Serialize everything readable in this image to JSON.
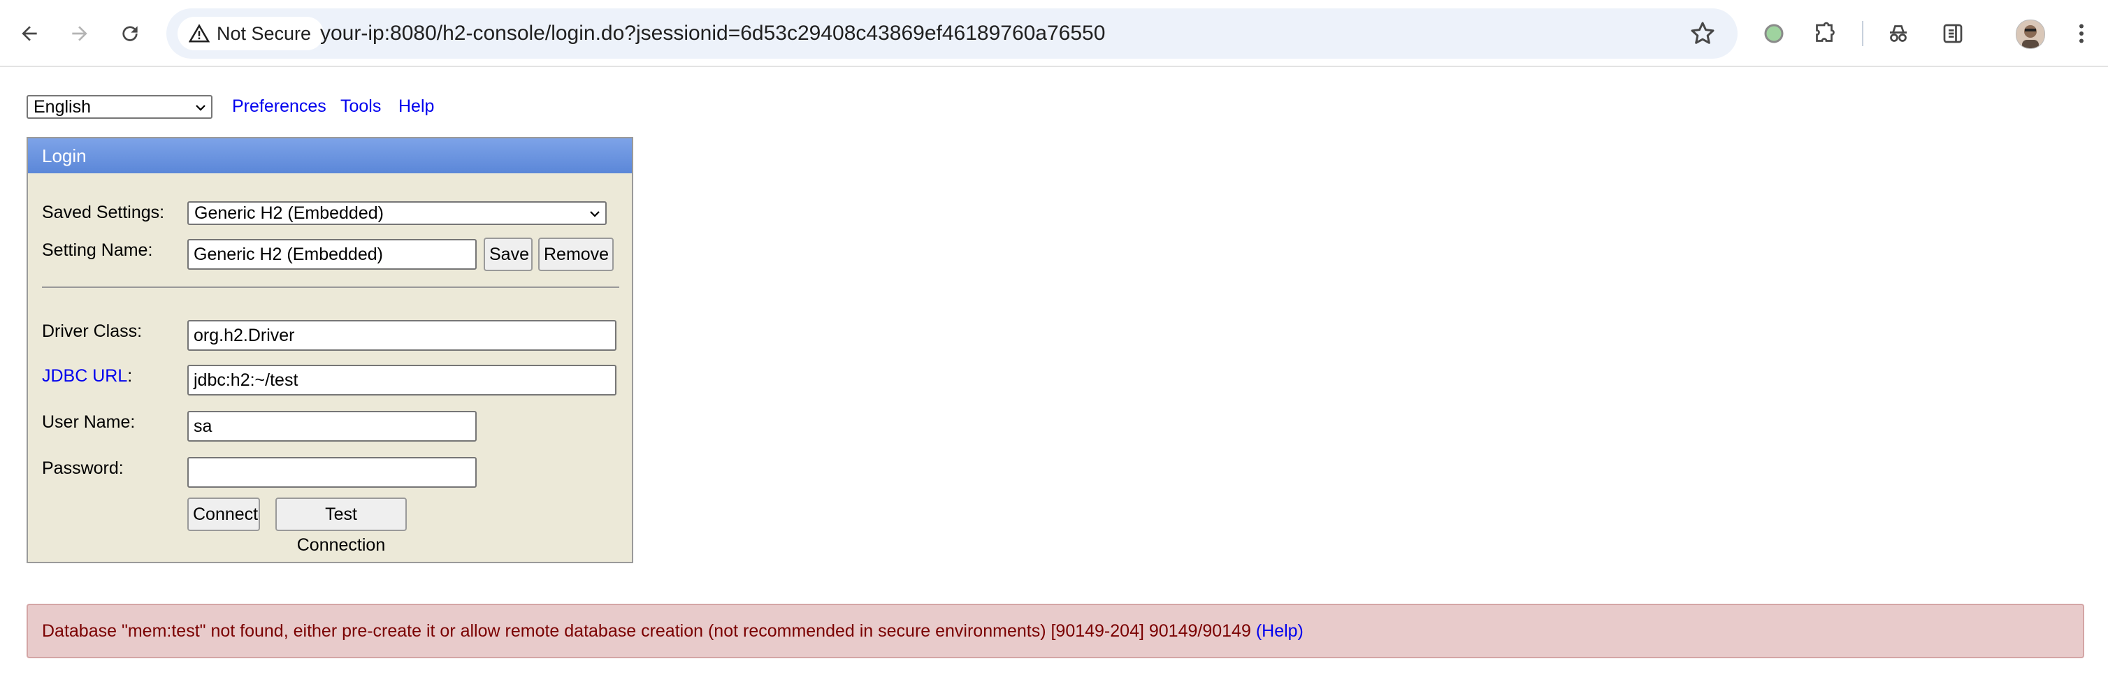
{
  "browser": {
    "security_label": "Not Secure",
    "url": "your-ip:8080/h2-console/login.do?jsessionid=6d53c29408c43869ef46189760a76550"
  },
  "topbar": {
    "language": "English",
    "links": [
      "Preferences",
      "Tools",
      "Help"
    ]
  },
  "login": {
    "title": "Login",
    "saved_settings_label": "Saved Settings:",
    "saved_settings_value": "Generic H2 (Embedded)",
    "setting_name_label": "Setting Name:",
    "setting_name_value": "Generic H2 (Embedded)",
    "save_label": "Save",
    "remove_label": "Remove",
    "driver_class_label": "Driver Class:",
    "driver_class_value": "org.h2.Driver",
    "jdbc_url_link": "JDBC URL",
    "jdbc_url_colon": ":",
    "jdbc_url_value": "jdbc:h2:~/test",
    "user_name_label": "User Name:",
    "user_name_value": "sa",
    "password_label": "Password:",
    "password_value": "",
    "connect_label": "Connect",
    "test_connection_label": "Test Connection"
  },
  "error": {
    "message": "Database \"mem:test\" not found, either pre-create it or allow remote database creation (not recommended in secure environments) [90149-204] 90149/90149",
    "help_link": "(Help)"
  },
  "icons": {
    "back": "arrow-left-icon",
    "forward": "arrow-right-icon",
    "reload": "reload-icon",
    "security": "warning-icon",
    "bookmark": "star-icon",
    "extensions": "puzzle-icon",
    "incognito": "incognito-icon",
    "reading": "side-panel-icon",
    "menu": "kebab-icon"
  },
  "colors": {
    "link": "#0000ee",
    "login_header": "#6e96e0",
    "login_bg": "#ece9d8",
    "error_bg": "#e8cbcb",
    "error_text": "#7a0000"
  }
}
